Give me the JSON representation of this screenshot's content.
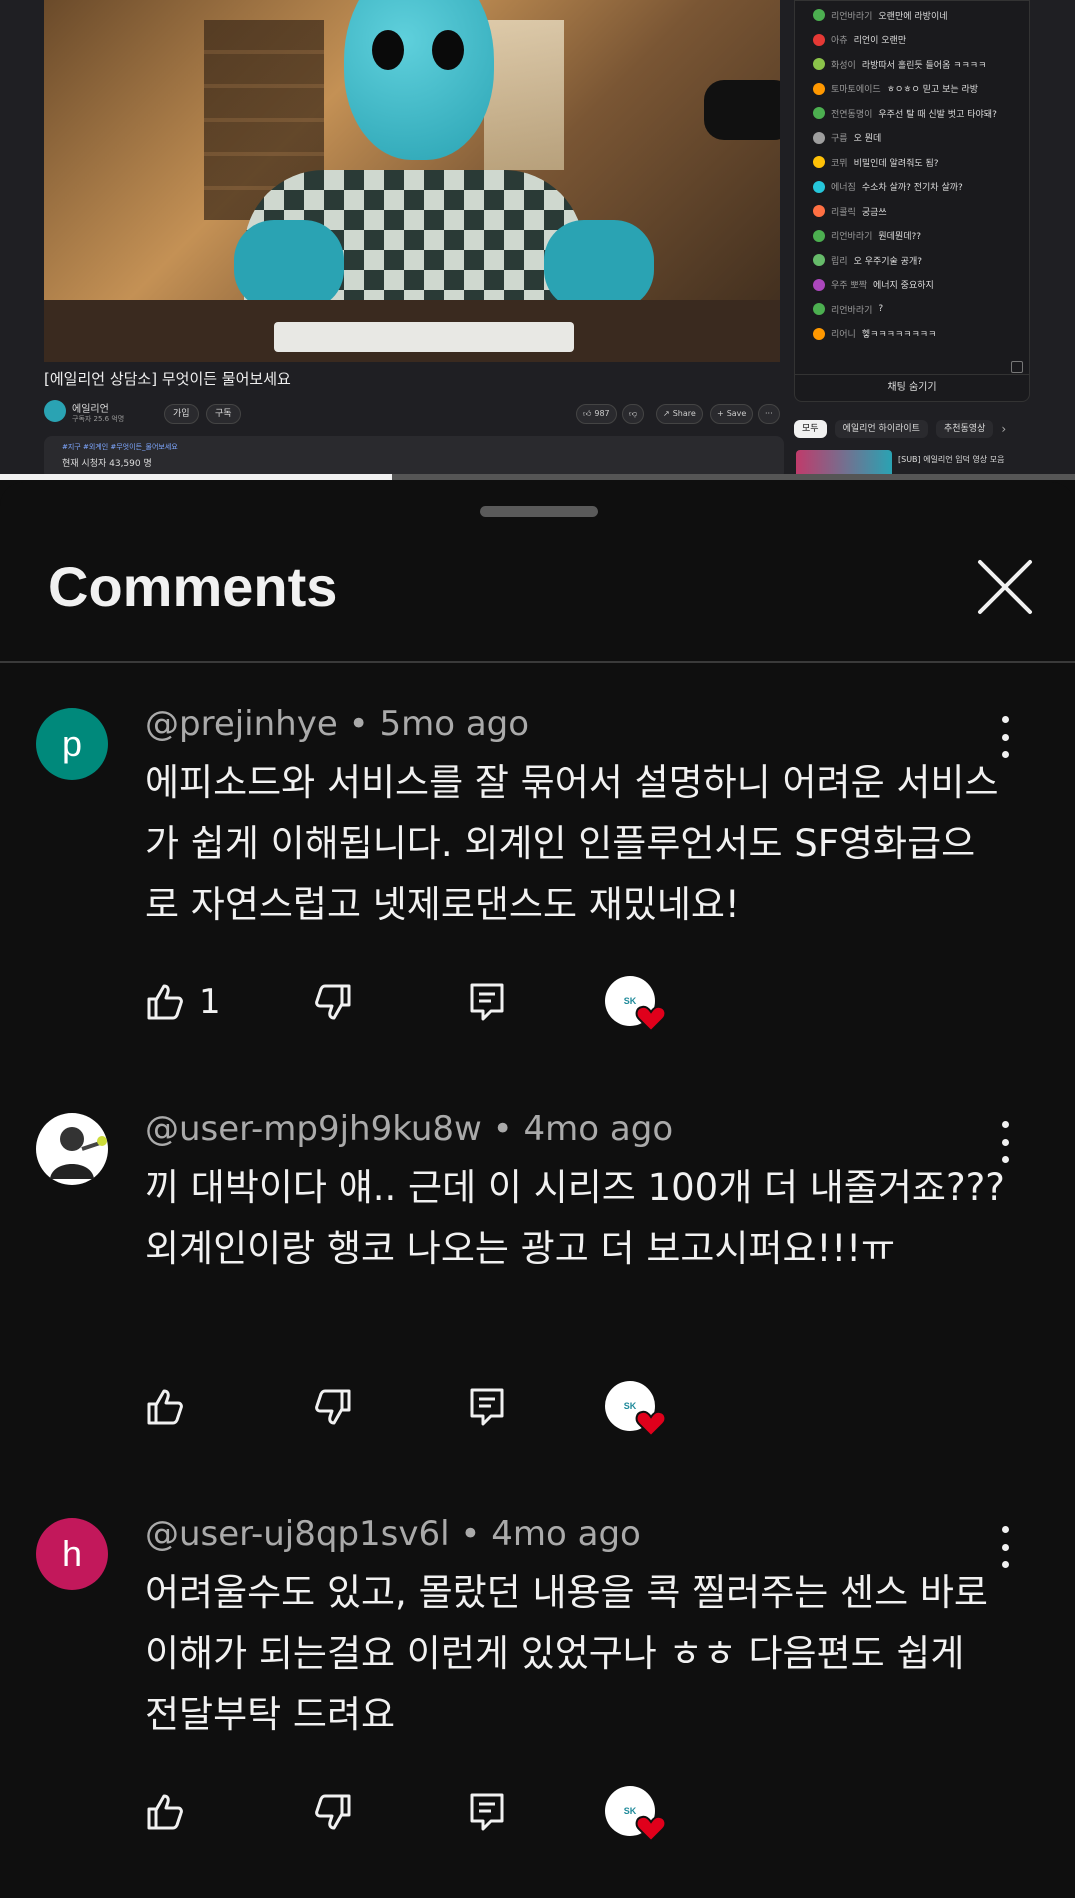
{
  "video": {
    "title": "[에일리언 상담소] 무엇이든 물어보세요",
    "channel_name": "에일리언",
    "subscribers": "구독자 25.6 억명",
    "join_label": "가입",
    "subscribe_label": "구독",
    "like_count": "987",
    "share_label": "Share",
    "save_label": "Save",
    "more_label": "···",
    "tags": "#지구 #외계인 #무엇이든_물어보세요",
    "viewers": "현재 시청자 43,590 명",
    "progress": 0.365
  },
  "live_chat": {
    "messages": [
      {
        "user": "리언바라기",
        "text": "오랜만에 라방이네"
      },
      {
        "user": "아츄",
        "text": "리언이 오랜만"
      },
      {
        "user": "화성이",
        "text": "라방따서 홀린듯 들어옴 ㅋㅋㅋㅋ"
      },
      {
        "user": "토마토에이드",
        "text": "ㅎㅇㅎㅇ 믿고 보는 라방"
      },
      {
        "user": "전연동명이",
        "text": "우주선 탈 때 신발 벗고 타야돼?"
      },
      {
        "user": "구름",
        "text": "오 뭔데"
      },
      {
        "user": "코뮈",
        "text": "비밀인데 알려줘도 됨?"
      },
      {
        "user": "에너짐",
        "text": "수소차 살까? 전기차 살까?"
      },
      {
        "user": "리콜릭",
        "text": "궁금쓰"
      },
      {
        "user": "리언바라기",
        "text": "뭔데뭔데??"
      },
      {
        "user": "립리",
        "text": "오 우주기술 공개?"
      },
      {
        "user": "우주 뽀짝",
        "text": "에너지 중요하지"
      },
      {
        "user": "리언바라기",
        "text": "?"
      },
      {
        "user": "리어니",
        "text": "헿ㅋㅋㅋㅋㅋㅋㅋㅋ"
      }
    ],
    "hide_label": "채팅 숨기기"
  },
  "chips": {
    "all": "모두",
    "highlights": "에일리언 하이라이트",
    "recommended": "추천동영상"
  },
  "recommendation": {
    "title": "[SUB] 에일리언 입덕 영상 모음"
  },
  "comments_sheet": {
    "title": "Comments",
    "comments": [
      {
        "avatar_letter": "p",
        "avatar_color": "#00897b",
        "author": "@prejinhye",
        "time": "5mo ago",
        "text": "에피소드와 서비스를 잘 묶어서 설명하니 어려운 서비스가 쉽게 이해됩니다. 외계인 인플루언서도 SF영화급으로 자연스럽고 넷제로댄스도 재밌네요!",
        "likes": "1",
        "hearted_by": "SK"
      },
      {
        "avatar_letter": "",
        "avatar_color": "#ffffff",
        "author": "@user-mp9jh9ku8w",
        "time": "4mo ago",
        "text": "끼 대박이다 얘.. 근데 이 시리즈 100개 더 내줄거죠??? 외계인이랑 행코 나오는 광고 더 보고시퍼요!!!ㅠ",
        "likes": "",
        "hearted_by": "SK"
      },
      {
        "avatar_letter": "h",
        "avatar_color": "#c2185b",
        "author": "@user-uj8qp1sv6l",
        "time": "4mo ago",
        "text": "어려울수도 있고, 몰랐던 내용을 콕 찔러주는 센스 바로이해가 되는걸요 이런게 있었구나 ㅎㅎ 다음편도 쉽게 전달부탁 드려요",
        "likes": "",
        "hearted_by": "SK"
      }
    ]
  }
}
